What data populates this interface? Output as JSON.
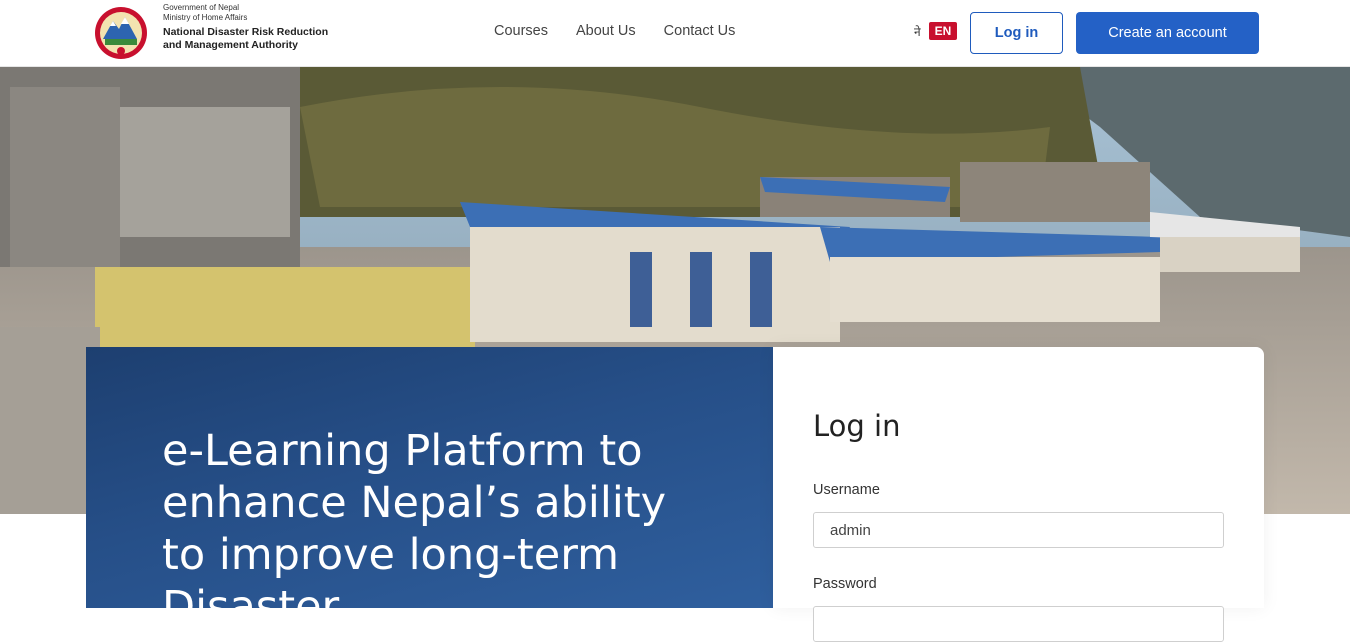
{
  "header": {
    "org_line1": "Government of Nepal",
    "org_line2": "Ministry of Home Affairs",
    "org_name_line1": "National Disaster Risk Reduction",
    "org_name_line2": "and Management Authority",
    "nav": [
      "Courses",
      "About Us",
      "Contact Us"
    ],
    "lang_ne": "ने",
    "lang_en": "EN",
    "login_label": "Log in",
    "create_label": "Create an account"
  },
  "banner": {
    "headline": "e-Learning Platform to enhance Nepal’s ability to improve long-term Disaster"
  },
  "login": {
    "title": "Log in",
    "username_label": "Username",
    "username_value": "admin",
    "password_label": "Password"
  },
  "colors": {
    "primary": "#2461c6",
    "lang_badge": "#c8102e",
    "banner": "#264f88"
  }
}
